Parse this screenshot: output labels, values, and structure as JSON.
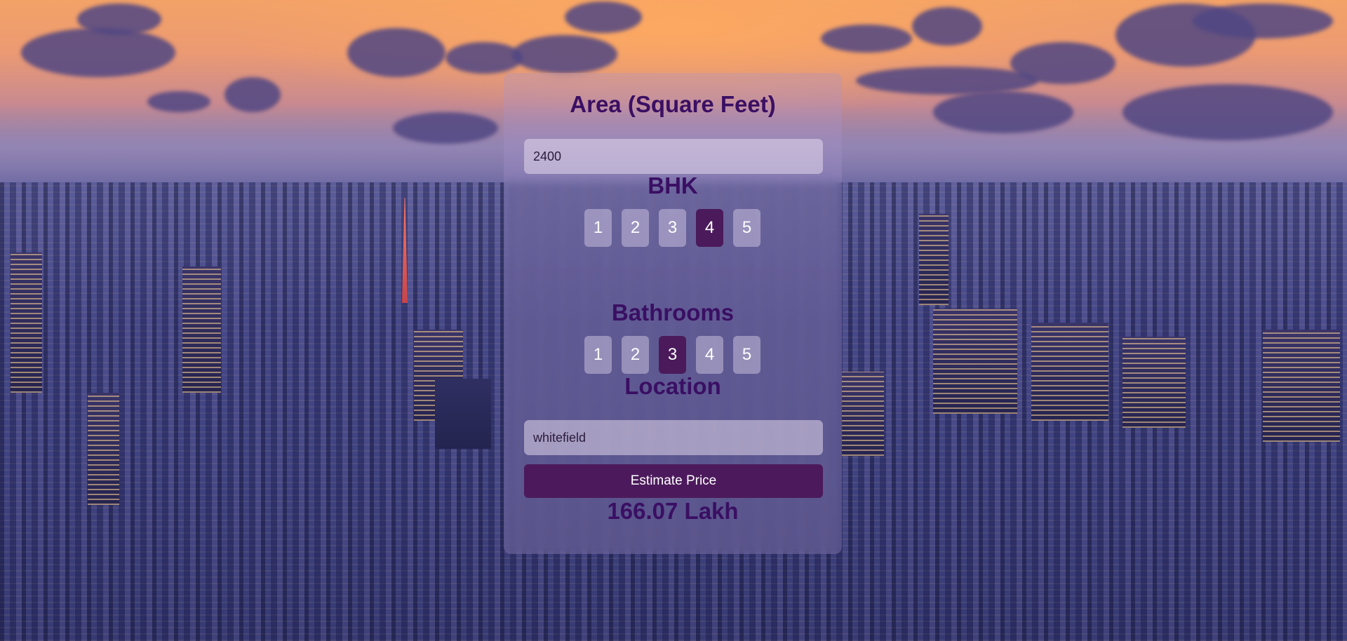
{
  "form": {
    "area": {
      "label": "Area (Square Feet)",
      "value": "2400"
    },
    "bhk": {
      "label": "BHK",
      "options": [
        "1",
        "2",
        "3",
        "4",
        "5"
      ],
      "selected": "4"
    },
    "bathrooms": {
      "label": "Bathrooms",
      "options": [
        "1",
        "2",
        "3",
        "4",
        "5"
      ],
      "selected": "3"
    },
    "location": {
      "label": "Location",
      "value": "whitefield"
    },
    "submit_label": "Estimate Price",
    "result": "166.07 Lakh"
  },
  "colors": {
    "accent": "#4c1a5c",
    "heading": "#3a0f63"
  }
}
